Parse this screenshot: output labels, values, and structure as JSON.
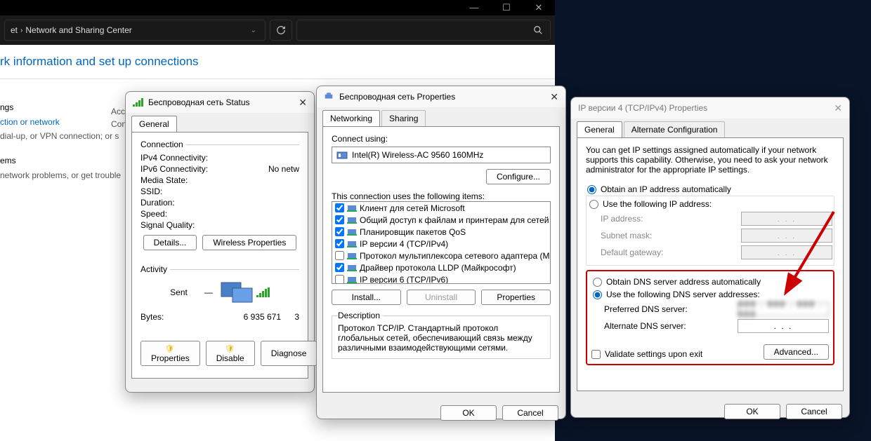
{
  "explorer": {
    "crumb_last_partial": "et",
    "crumb_current": "Network and Sharing Center",
    "header": "rk information and set up connections",
    "left": {
      "access_label_1": "Acc",
      "access_label_2": "Con",
      "settings_hdr": "ngs",
      "link1": "ction or network",
      "link1_sub": "dial-up, or VPN connection; or s",
      "probs_hdr": "ems",
      "probs_sub": "network problems, or get trouble"
    }
  },
  "status": {
    "title": "Беспроводная сеть Status",
    "tab_general": "General",
    "group_connection": "Connection",
    "ipv4_label": "IPv4 Connectivity:",
    "ipv6_label": "IPv6 Connectivity:",
    "ipv6_value": "No netw",
    "media_label": "Media State:",
    "ssid_label": "SSID:",
    "duration_label": "Duration:",
    "speed_label": "Speed:",
    "signal_label": "Signal Quality:",
    "btn_details": "Details...",
    "btn_wprops": "Wireless Properties",
    "group_activity": "Activity",
    "sent_label": "Sent",
    "bytes_label": "Bytes:",
    "bytes_sent": "6 935 671",
    "bytes_recv_partial": "3",
    "btn_properties": "Properties",
    "btn_disable": "Disable",
    "btn_diagnose": "Diagnose"
  },
  "props": {
    "title": "Беспроводная сеть Properties",
    "tab_networking": "Networking",
    "tab_sharing": "Sharing",
    "connect_using": "Connect using:",
    "adapter": "Intel(R) Wireless-AC 9560 160MHz",
    "btn_configure": "Configure...",
    "items_label": "This connection uses the following items:",
    "items": [
      {
        "checked": true,
        "label": "Клиент для сетей Microsoft"
      },
      {
        "checked": true,
        "label": "Общий доступ к файлам и принтерам для сетей Mi"
      },
      {
        "checked": true,
        "label": "Планировщик пакетов QoS"
      },
      {
        "checked": true,
        "label": "IP версии 4 (TCP/IPv4)"
      },
      {
        "checked": false,
        "label": "Протокол мультиплексора сетевого адаптера (Ма"
      },
      {
        "checked": true,
        "label": "Драйвер протокола LLDP (Майкрософт)"
      },
      {
        "checked": false,
        "label": "IP версии 6 (TCP/IPv6)"
      }
    ],
    "btn_install": "Install...",
    "btn_uninstall": "Uninstall",
    "btn_props": "Properties",
    "desc_title": "Description",
    "desc": "Протокол TCP/IP. Стандартный протокол глобальных сетей, обеспечивающий связь между различными взаимодействующими сетями.",
    "btn_ok": "OK",
    "btn_cancel": "Cancel"
  },
  "ipv4": {
    "title": "IP версии 4 (TCP/IPv4) Properties",
    "tab_general": "General",
    "tab_alt": "Alternate Configuration",
    "intro": "You can get IP settings assigned automatically if your network supports this capability. Otherwise, you need to ask your network administrator for the appropriate IP settings.",
    "radio_auto_ip": "Obtain an IP address automatically",
    "radio_manual_ip": "Use the following IP address:",
    "ip_address": "IP address:",
    "subnet": "Subnet mask:",
    "gateway": "Default gateway:",
    "radio_auto_dns": "Obtain DNS server address automatically",
    "radio_manual_dns": "Use the following DNS server addresses:",
    "pref_dns": "Preferred DNS server:",
    "alt_dns": "Alternate DNS server:",
    "dot_placeholder": ".       .       .",
    "validate": "Validate settings upon exit",
    "btn_advanced": "Advanced...",
    "btn_ok": "OK",
    "btn_cancel": "Cancel"
  }
}
